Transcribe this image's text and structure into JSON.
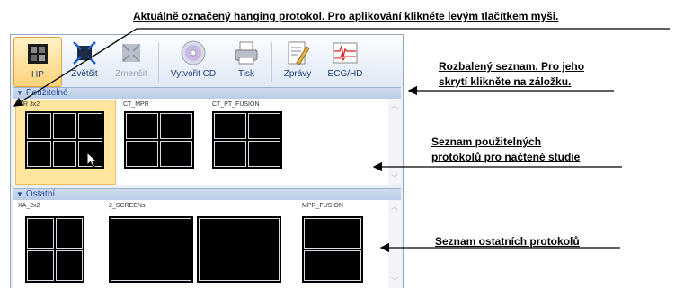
{
  "annotations": {
    "top": "Aktuálně označený hanging protokol. Pro aplikování klikněte levým tlačítkem myši.",
    "expanded_list_line1": "Rozbalený seznam. Pro jeho",
    "expanded_list_line2": "skrytí klikněte na záložku.",
    "usable_list_line1": "Seznam použitelných",
    "usable_list_line2": "protokolů pro načtené studie",
    "other_list": "Seznam ostatních protokolů"
  },
  "toolbar": {
    "hp": "HP",
    "enlarge": "Zvětšit",
    "shrink": "Zmenšit",
    "create_cd": "Vytvořit CD",
    "print": "Tisk",
    "reports": "Zprávy",
    "ecg": "ECG/HD"
  },
  "sections": {
    "usable": {
      "title": "Použitelné",
      "protocols": [
        "MR 3x2",
        "CT_MPR",
        "CT_PT_FUSION"
      ]
    },
    "other": {
      "title": "Ostatní",
      "protocols": [
        "XA_2x2",
        "2_SCREENs",
        "MPR_FUSION"
      ]
    }
  },
  "colors": {
    "selected": "#ffe59d",
    "header": "#c6d6ee",
    "accent": "#2a4f9b"
  }
}
